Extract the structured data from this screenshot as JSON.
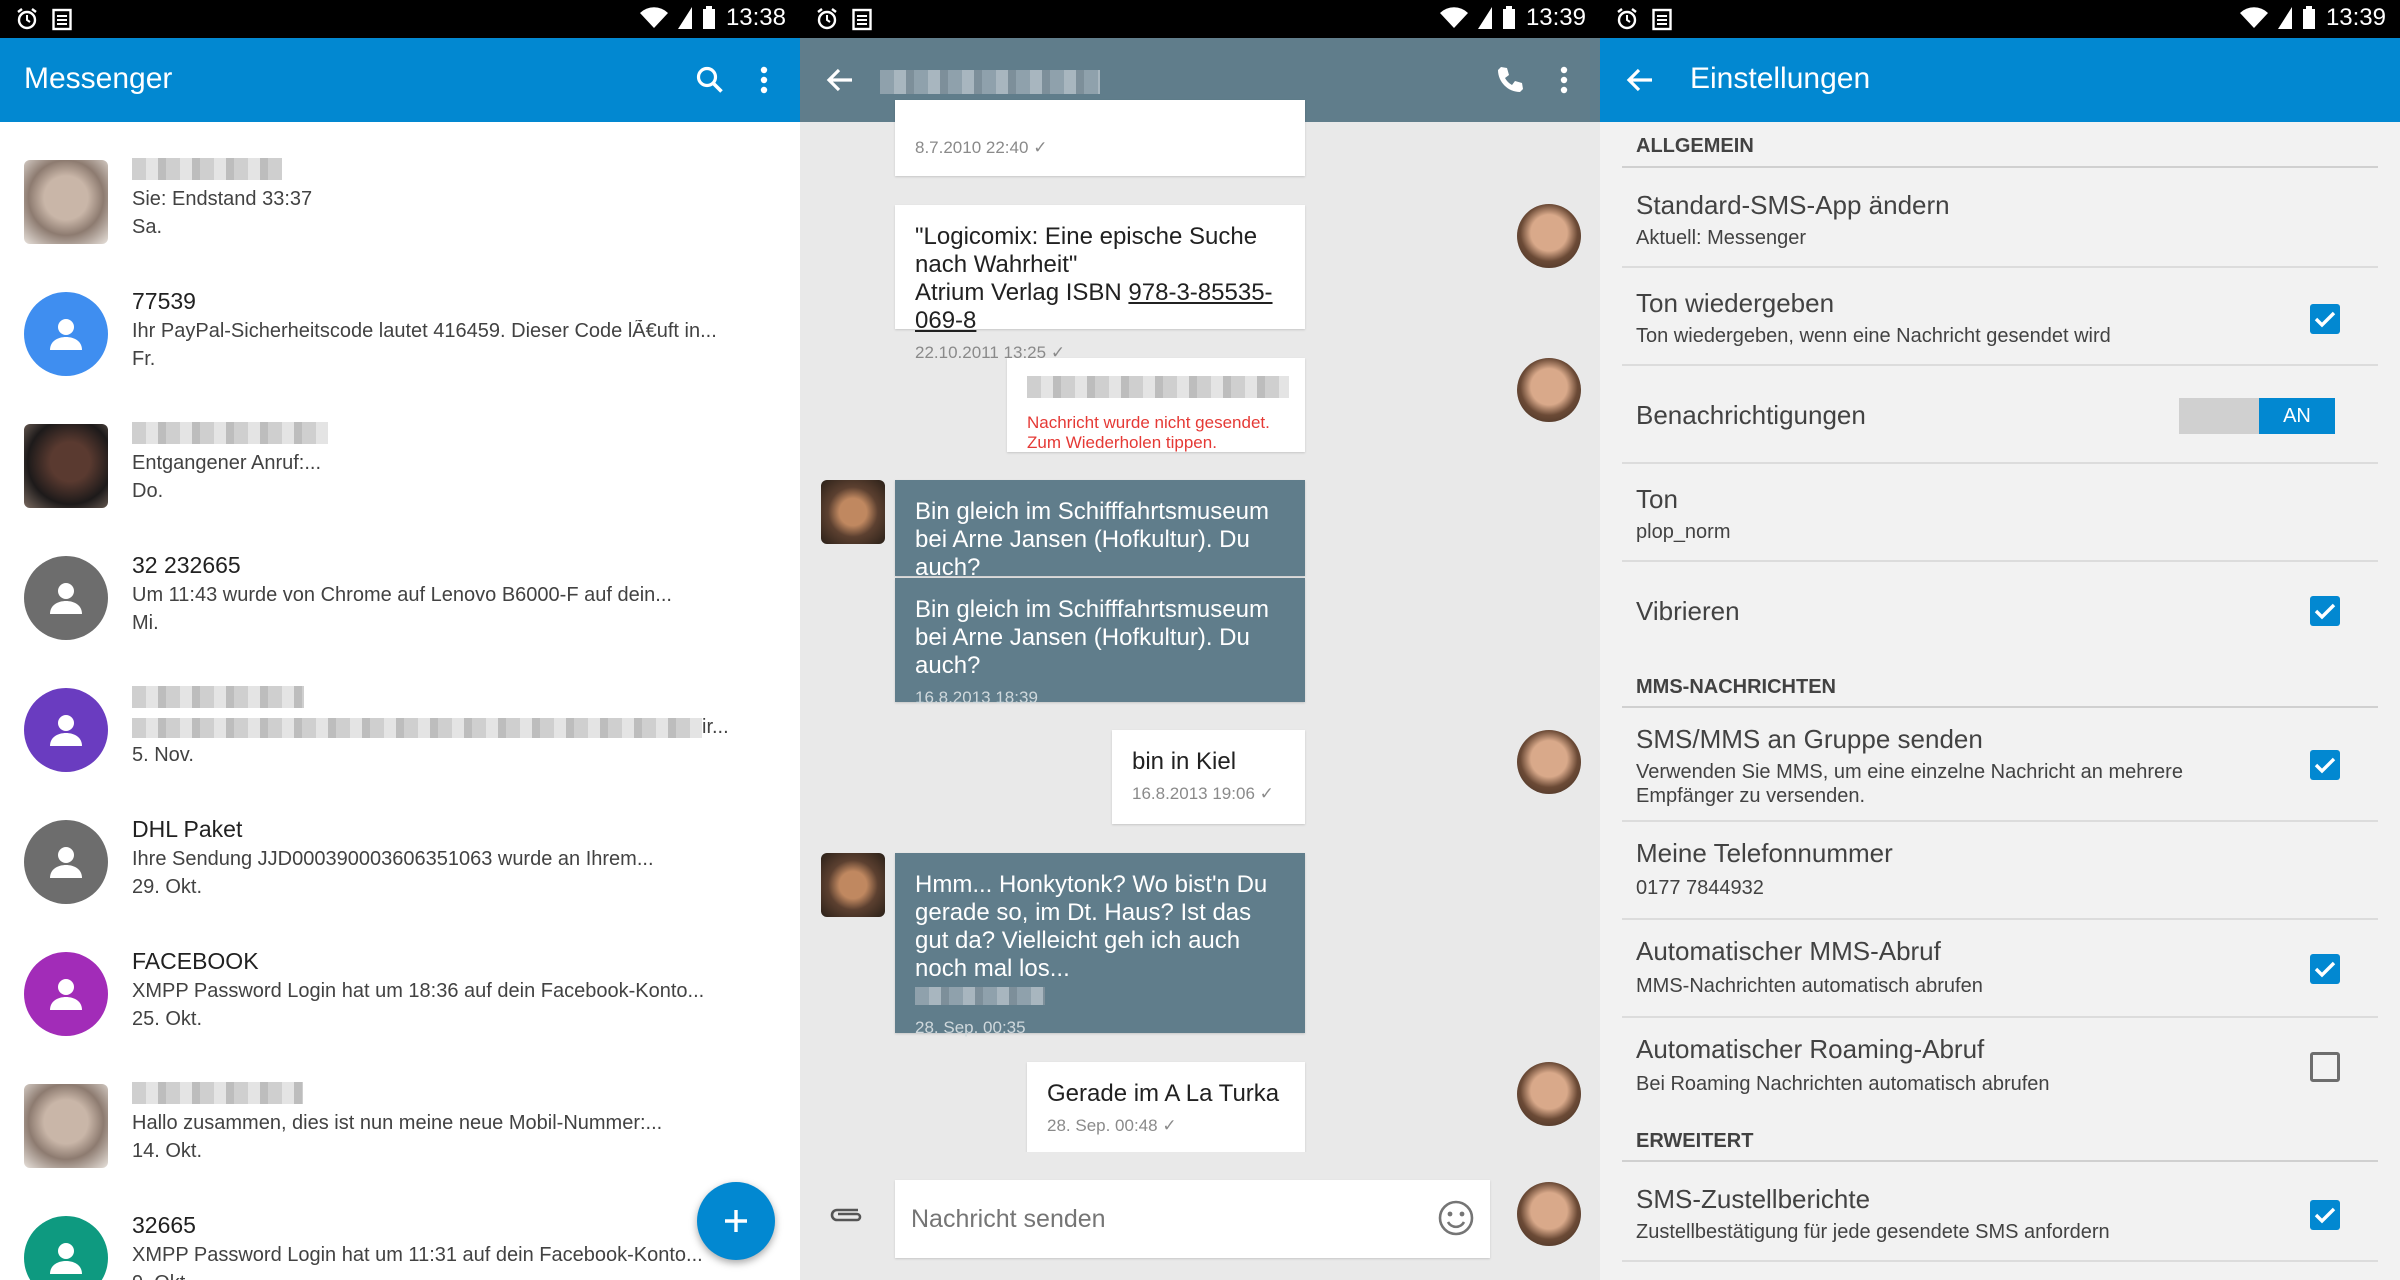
{
  "status_bars": [
    {
      "time": "13:38"
    },
    {
      "time": "13:39"
    },
    {
      "time": "13:39"
    }
  ],
  "messenger": {
    "title": "Messenger",
    "accent": "#0288d1",
    "conversations": [
      {
        "name": "",
        "snippet": "Sie: Endstand 33:37",
        "date": "Sa.",
        "avatar": "photo"
      },
      {
        "name": "77539",
        "snippet": "Ihr PayPal-Sicherheitscode lautet 416459. Dieser Code lÃ€uft in...",
        "date": "Fr.",
        "avatar": "person-icon",
        "color": "#3f8ef0"
      },
      {
        "name": "",
        "snippet": "Entgangener Anruf:...",
        "date": "Do.",
        "avatar": "photo"
      },
      {
        "name": "32 232665",
        "snippet": "Um 11:43 wurde von Chrome auf Lenovo B6000-F auf dein...",
        "date": "Mi.",
        "avatar": "person-icon",
        "color": "#6d6d6d"
      },
      {
        "name": "",
        "snippet": "ir...",
        "date": "5. Nov.",
        "avatar": "person-icon",
        "color": "#6a3cc0"
      },
      {
        "name": "DHL Paket",
        "snippet": "Ihre Sendung JJD000390003606351063 wurde an Ihrem...",
        "date": "29. Okt.",
        "avatar": "person-icon",
        "color": "#6d6d6d"
      },
      {
        "name": "FACEBOOK",
        "snippet": "XMPP Password Login hat um 18:36 auf dein Facebook-Konto...",
        "date": "25. Okt.",
        "avatar": "person-icon",
        "color": "#a22cb8"
      },
      {
        "name": "",
        "snippet": "Hallo zusammen, dies ist nun meine neue Mobil-Nummer:...",
        "date": "14. Okt.",
        "avatar": "photo"
      },
      {
        "name": "32665",
        "snippet": "XMPP Password Login hat um 11:31 auf dein Facebook-Konto...",
        "date": "9. Okt.",
        "avatar": "person-icon",
        "color": "#0e9a80"
      }
    ]
  },
  "chat": {
    "header_color": "#607d8b",
    "messages": [
      {
        "from": "me",
        "text": "",
        "meta": "8.7.2010 22:40"
      },
      {
        "from": "me",
        "text_line1": "\"Logicomix: Eine epische Suche nach Wahrheit\"",
        "text_line2_prefix": "Atrium Verlag ISBN ",
        "isbn": "978-3-85535-069-8",
        "meta": "22.10.2011 13:25"
      },
      {
        "from": "me",
        "text": "",
        "error": "Nachricht wurde nicht gesendet. Zum Wiederholen tippen."
      },
      {
        "from": "them",
        "text": "Bin gleich im Schifffahrtsmuseum bei Arne Jansen (Hofkultur). Du auch?"
      },
      {
        "from": "them",
        "text": "Bin gleich im Schifffahrtsmuseum bei Arne Jansen (Hofkultur). Du auch?",
        "meta": "16.8.2013 18:39"
      },
      {
        "from": "me",
        "text": "bin in Kiel",
        "meta": "16.8.2013 19:06"
      },
      {
        "from": "them",
        "text": "Hmm... Honkytonk? Wo bist'n Du gerade so, im Dt. Haus? Ist das gut da? Vielleicht geh ich auch noch mal los...",
        "meta": "28. Sep. 00:35"
      },
      {
        "from": "me",
        "text": "Gerade im A La Turka",
        "meta": "28. Sep. 00:48"
      }
    ],
    "composer_placeholder": "Nachricht senden"
  },
  "settings": {
    "title": "Einstellungen",
    "sections": [
      {
        "header": "ALLGEMEIN",
        "items": [
          {
            "title": "Standard-SMS-App ändern",
            "subtitle": "Aktuell: Messenger",
            "control": "none"
          },
          {
            "title": "Ton wiedergeben",
            "subtitle": "Ton wiedergeben, wenn eine Nachricht gesendet wird",
            "control": "checkbox",
            "checked": true
          },
          {
            "title": "Benachrichtigungen",
            "subtitle": "",
            "control": "toggle",
            "toggle_label": "AN"
          },
          {
            "title": "Ton",
            "subtitle": "plop_norm",
            "control": "none"
          },
          {
            "title": "Vibrieren",
            "subtitle": "",
            "control": "checkbox",
            "checked": true
          }
        ]
      },
      {
        "header": "MMS-NACHRICHTEN",
        "items": [
          {
            "title": "SMS/MMS an Gruppe senden",
            "subtitle": "Verwenden Sie MMS, um eine einzelne Nachricht an mehrere Empfänger zu versenden.",
            "control": "checkbox",
            "checked": true
          },
          {
            "title": "Meine Telefonnummer",
            "subtitle": "0177 7844932",
            "control": "none"
          },
          {
            "title": "Automatischer MMS-Abruf",
            "subtitle": "MMS-Nachrichten automatisch abrufen",
            "control": "checkbox",
            "checked": true
          },
          {
            "title": "Automatischer Roaming-Abruf",
            "subtitle": "Bei Roaming Nachrichten automatisch abrufen",
            "control": "checkbox",
            "checked": false
          }
        ]
      },
      {
        "header": "ERWEITERT",
        "items": [
          {
            "title": "SMS-Zustellberichte",
            "subtitle": "Zustellbestätigung für jede gesendete SMS anfordern",
            "control": "checkbox",
            "checked": true
          }
        ]
      }
    ]
  }
}
